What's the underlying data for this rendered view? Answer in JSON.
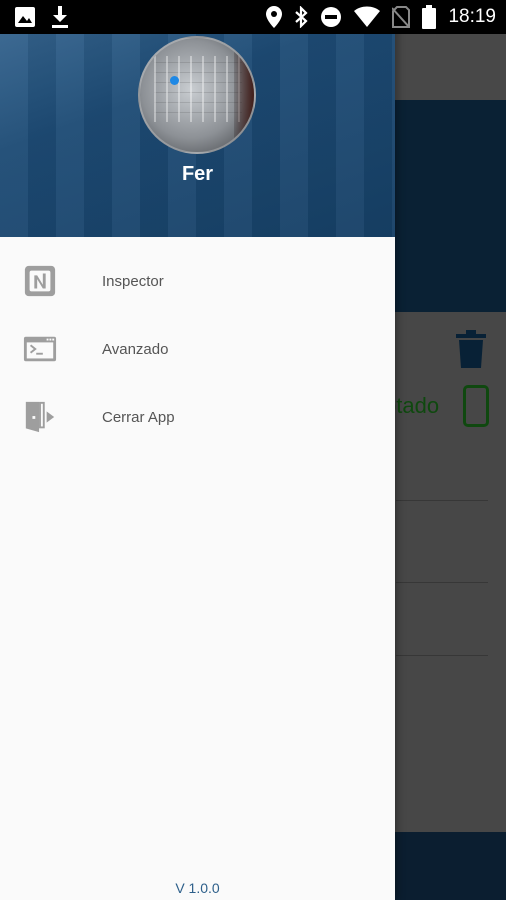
{
  "status_bar": {
    "time": "18:19",
    "left_icons": [
      "image-icon",
      "download-icon"
    ],
    "right_icons": [
      "location-icon",
      "bluetooth-icon",
      "do-not-disturb-icon",
      "wifi-icon",
      "no-sim-icon",
      "battery-icon"
    ]
  },
  "drawer": {
    "user_name": "Fer",
    "menu": [
      {
        "label": "Inspector",
        "icon": "nfc-icon"
      },
      {
        "label": "Avanzado",
        "icon": "terminal-icon"
      },
      {
        "label": "Cerrar App",
        "icon": "exit-door-icon"
      }
    ],
    "version": "V 1.0.0"
  },
  "background": {
    "status_text": "ptado",
    "icons": [
      "trash-icon",
      "phone-icon"
    ]
  },
  "colors": {
    "header_blue": "#1d4b75",
    "accent_green": "#1b7d1b",
    "version_blue": "#2d5f8a"
  }
}
